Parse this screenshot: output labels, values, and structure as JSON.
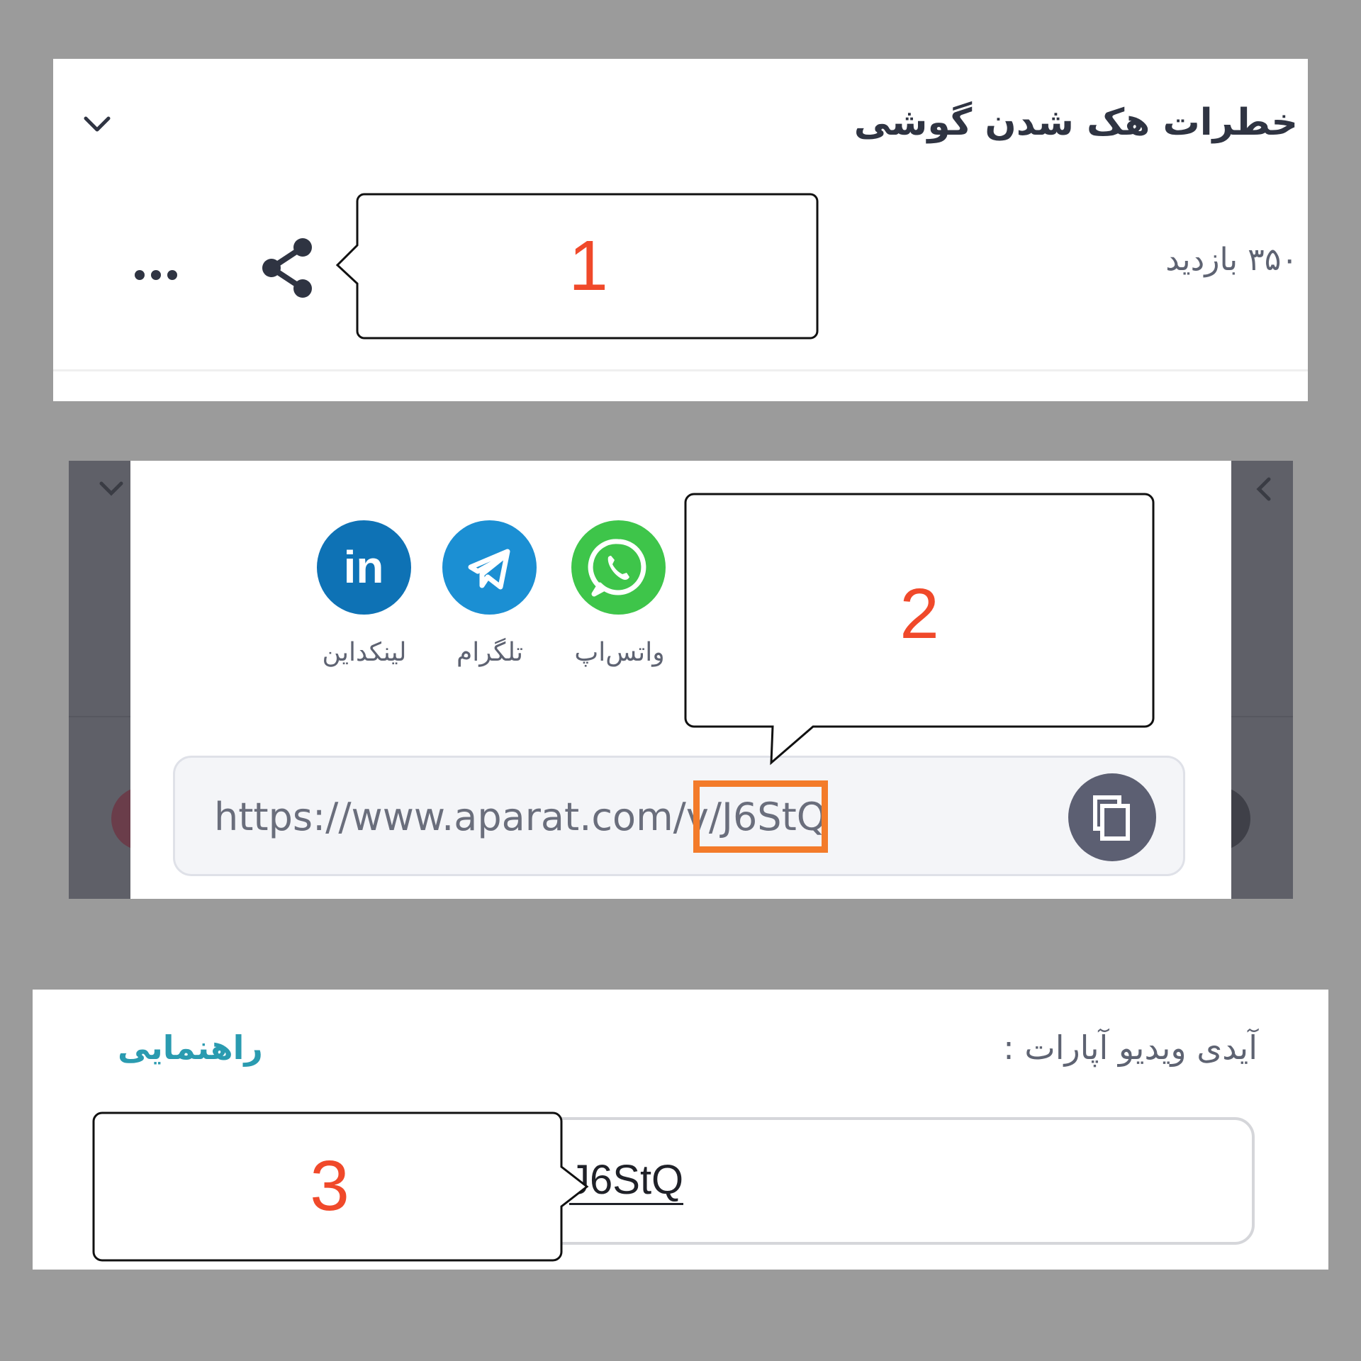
{
  "panel1": {
    "title": "خطرات هک شدن گوشی",
    "views": "۳۵۰ بازدید",
    "icons": [
      "chevron-down-icon",
      "share-icon",
      "more-icon"
    ]
  },
  "panel2": {
    "share_targets": [
      {
        "label": "واتس‌اپ",
        "icon": "whatsapp-icon",
        "color": "#3ec54a"
      },
      {
        "label": "تلگرام",
        "icon": "telegram-icon",
        "color": "#1b8fd3"
      },
      {
        "label": "لینکداین",
        "icon": "linkedin-icon",
        "color": "#0e72b5"
      }
    ],
    "url": "https://www.aparat.com/v/J6StQ",
    "copy_icon": "copy-icon",
    "highlight_color": "#f37b2a"
  },
  "panel3": {
    "label": "آیدی ویدیو آپارات :",
    "help_link": "راهنمایی",
    "input_value": "J6StQ",
    "help_color": "#2a9bb0"
  },
  "callouts": [
    {
      "number": "1"
    },
    {
      "number": "2"
    },
    {
      "number": "3"
    }
  ],
  "callout_color": "#f0492a"
}
